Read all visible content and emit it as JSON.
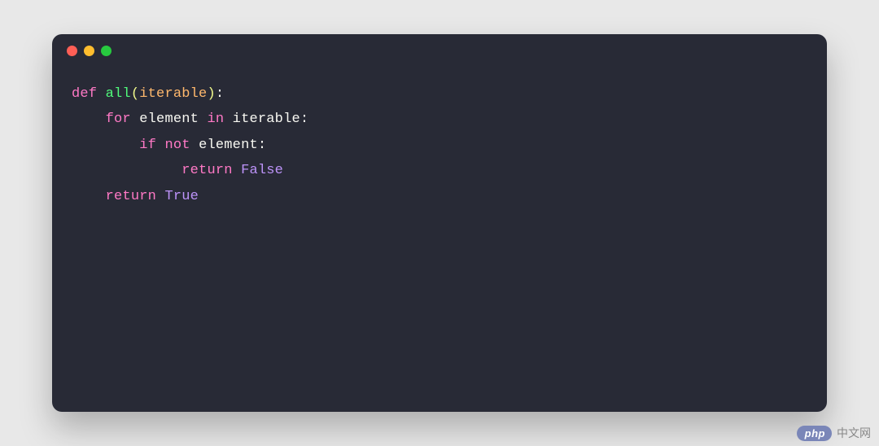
{
  "window": {
    "buttons": {
      "close": "close",
      "minimize": "minimize",
      "zoom": "zoom"
    }
  },
  "code": {
    "lines": [
      {
        "indent": 0,
        "tokens": [
          {
            "cls": "kw-def",
            "t": "def"
          },
          {
            "cls": "plain",
            "t": " "
          },
          {
            "cls": "fn-name",
            "t": "all"
          },
          {
            "cls": "paren",
            "t": "("
          },
          {
            "cls": "param",
            "t": "iterable"
          },
          {
            "cls": "paren",
            "t": ")"
          },
          {
            "cls": "colon",
            "t": ":"
          }
        ]
      },
      {
        "indent": 1,
        "tokens": [
          {
            "cls": "kw-ctrl",
            "t": "for"
          },
          {
            "cls": "plain",
            "t": " "
          },
          {
            "cls": "ident",
            "t": "element"
          },
          {
            "cls": "plain",
            "t": " "
          },
          {
            "cls": "kw-in",
            "t": "in"
          },
          {
            "cls": "plain",
            "t": " "
          },
          {
            "cls": "ident",
            "t": "iterable"
          },
          {
            "cls": "colon",
            "t": ":"
          }
        ]
      },
      {
        "indent": 2,
        "tokens": [
          {
            "cls": "kw-ctrl",
            "t": "if"
          },
          {
            "cls": "plain",
            "t": " "
          },
          {
            "cls": "kw-not",
            "t": "not"
          },
          {
            "cls": "plain",
            "t": " "
          },
          {
            "cls": "ident",
            "t": "element"
          },
          {
            "cls": "colon",
            "t": ":"
          }
        ]
      },
      {
        "indent": 3,
        "tokens": [
          {
            "cls": "plain",
            "t": " "
          },
          {
            "cls": "kw-ret",
            "t": "return"
          },
          {
            "cls": "plain",
            "t": " "
          },
          {
            "cls": "const",
            "t": "False"
          }
        ]
      },
      {
        "indent": 1,
        "tokens": [
          {
            "cls": "kw-ret",
            "t": "return"
          },
          {
            "cls": "plain",
            "t": " "
          },
          {
            "cls": "const",
            "t": "True"
          }
        ]
      }
    ]
  },
  "watermark": {
    "badge": "php",
    "text": "中文网"
  },
  "colors": {
    "bg": "#282a36",
    "pink": "#ff79c6",
    "green": "#50fa7b",
    "yellow": "#f1fa8c",
    "orange": "#ffb86c",
    "white": "#f8f8f2",
    "purple": "#bd93f9"
  }
}
